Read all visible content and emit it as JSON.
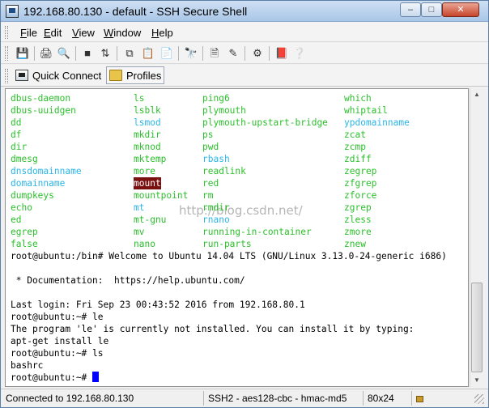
{
  "window": {
    "title": "192.168.80.130 - default - SSH Secure Shell"
  },
  "menu": {
    "items": [
      {
        "accel": "F",
        "rest": "ile"
      },
      {
        "accel": "E",
        "rest": "dit"
      },
      {
        "accel": "V",
        "rest": "iew"
      },
      {
        "accel": "W",
        "rest": "indow"
      },
      {
        "accel": "H",
        "rest": "elp"
      }
    ]
  },
  "quickbar": {
    "quick_connect": "Quick Connect",
    "profiles": "Profiles"
  },
  "terminal": {
    "ls_columns": [
      [
        {
          "t": "dbus-daemon",
          "c": "green"
        },
        {
          "t": "dbus-uuidgen",
          "c": "green"
        },
        {
          "t": "dd",
          "c": "green"
        },
        {
          "t": "df",
          "c": "green"
        },
        {
          "t": "dir",
          "c": "green"
        },
        {
          "t": "dmesg",
          "c": "green"
        },
        {
          "t": "dnsdomainname",
          "c": "cyan"
        },
        {
          "t": "domainname",
          "c": "cyan"
        },
        {
          "t": "dumpkeys",
          "c": "green"
        },
        {
          "t": "echo",
          "c": "green"
        },
        {
          "t": "ed",
          "c": "green"
        },
        {
          "t": "egrep",
          "c": "green"
        },
        {
          "t": "false",
          "c": "green"
        }
      ],
      [
        {
          "t": "ls",
          "c": "green"
        },
        {
          "t": "lsblk",
          "c": "green"
        },
        {
          "t": "lsmod",
          "c": "cyan"
        },
        {
          "t": "mkdir",
          "c": "green"
        },
        {
          "t": "mknod",
          "c": "green"
        },
        {
          "t": "mktemp",
          "c": "green"
        },
        {
          "t": "more",
          "c": "green"
        },
        {
          "t": "mount",
          "c": "highlight"
        },
        {
          "t": "mountpoint",
          "c": "green"
        },
        {
          "t": "mt",
          "c": "cyan"
        },
        {
          "t": "mt-gnu",
          "c": "green"
        },
        {
          "t": "mv",
          "c": "green"
        },
        {
          "t": "nano",
          "c": "green"
        }
      ],
      [
        {
          "t": "ping6",
          "c": "green"
        },
        {
          "t": "plymouth",
          "c": "green"
        },
        {
          "t": "plymouth-upstart-bridge",
          "c": "green"
        },
        {
          "t": "ps",
          "c": "green"
        },
        {
          "t": "pwd",
          "c": "green"
        },
        {
          "t": "rbash",
          "c": "cyan"
        },
        {
          "t": "readlink",
          "c": "green"
        },
        {
          "t": "red",
          "c": "green"
        },
        {
          "t": "rm",
          "c": "green"
        },
        {
          "t": "rmdir",
          "c": "green"
        },
        {
          "t": "rnano",
          "c": "cyan"
        },
        {
          "t": "running-in-container",
          "c": "green"
        },
        {
          "t": "run-parts",
          "c": "green"
        }
      ],
      [
        {
          "t": "which",
          "c": "green"
        },
        {
          "t": "whiptail",
          "c": "green"
        },
        {
          "t": "ypdomainname",
          "c": "cyan"
        },
        {
          "t": "zcat",
          "c": "green"
        },
        {
          "t": "zcmp",
          "c": "green"
        },
        {
          "t": "zdiff",
          "c": "green"
        },
        {
          "t": "zegrep",
          "c": "green"
        },
        {
          "t": "zfgrep",
          "c": "green"
        },
        {
          "t": "zforce",
          "c": "green"
        },
        {
          "t": "zgrep",
          "c": "green"
        },
        {
          "t": "zless",
          "c": "green"
        },
        {
          "t": "zmore",
          "c": "green"
        },
        {
          "t": "znew",
          "c": "green"
        }
      ]
    ],
    "lines": [
      "root@ubuntu:/bin# Welcome to Ubuntu 14.04 LTS (GNU/Linux 3.13.0-24-generic i686)",
      "",
      " * Documentation:  https://help.ubuntu.com/",
      "",
      "Last login: Fri Sep 23 00:43:52 2016 from 192.168.80.1",
      "root@ubuntu:~# le",
      "The program 'le' is currently not installed. You can install it by typing:",
      "apt-get install le",
      "root@ubuntu:~# ls",
      "bashrc",
      "root@ubuntu:~# "
    ],
    "watermark": "http://blog.csdn.net/"
  },
  "status": {
    "connected": "Connected to 192.168.80.130",
    "protocol": "SSH2 - aes128-cbc - hmac-md5",
    "size": "80x24"
  }
}
